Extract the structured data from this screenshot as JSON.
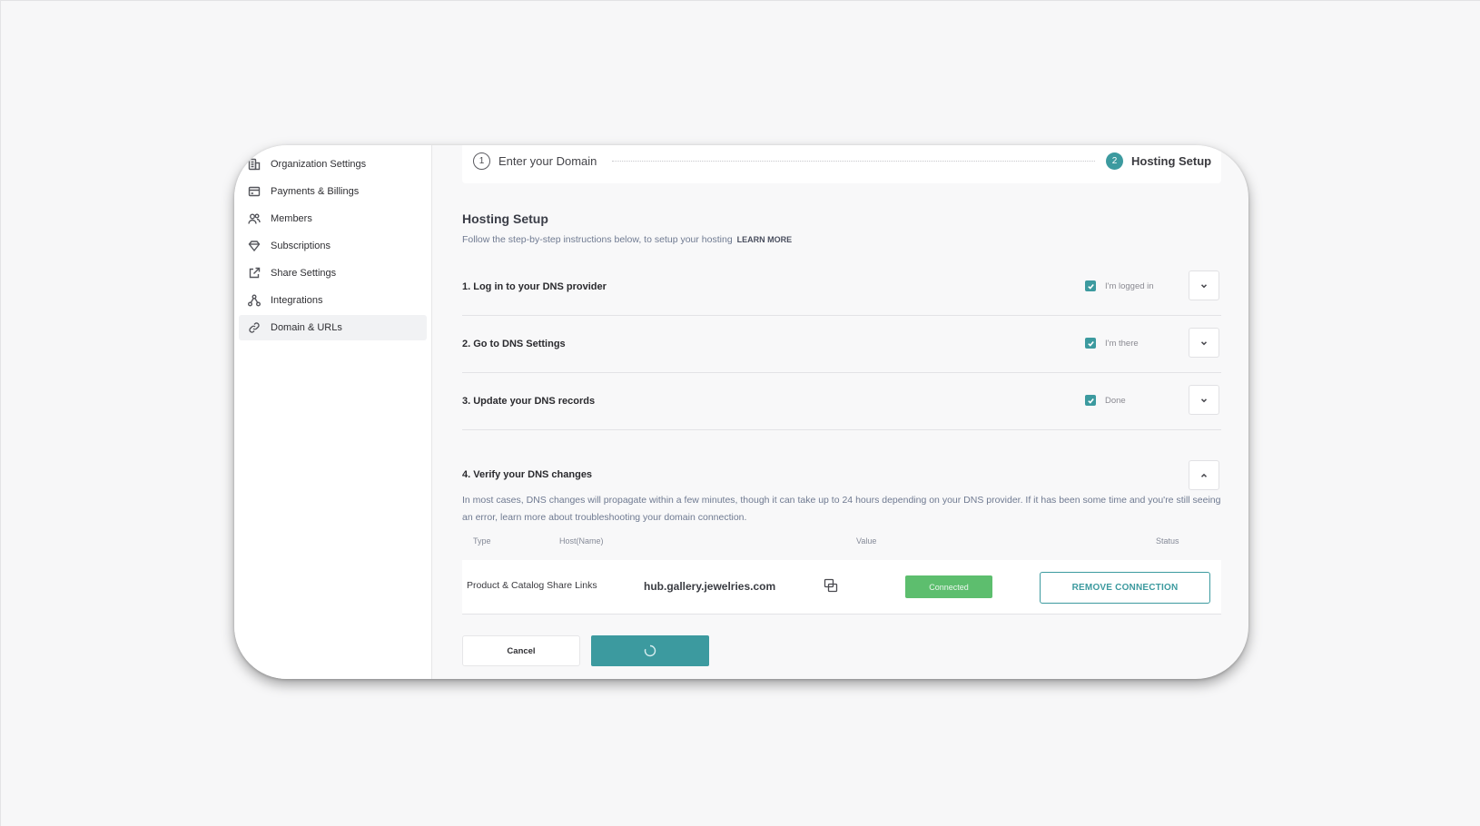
{
  "sidebar": {
    "items": [
      {
        "label": "Organization Settings",
        "icon": "building-icon"
      },
      {
        "label": "Payments & Billings",
        "icon": "card-icon"
      },
      {
        "label": "Members",
        "icon": "users-icon"
      },
      {
        "label": "Subscriptions",
        "icon": "tag-icon"
      },
      {
        "label": "Share Settings",
        "icon": "share-icon"
      },
      {
        "label": "Integrations",
        "icon": "integration-icon"
      },
      {
        "label": "Domain & URLs",
        "icon": "link-icon",
        "active": true
      }
    ]
  },
  "stepper": {
    "step1_number": "1",
    "step1_label": "Enter your Domain",
    "step2_number": "2",
    "step2_label": "Hosting Setup"
  },
  "header": {
    "title": "Hosting Setup",
    "subtitle": "Follow the step-by-step instructions below, to setup your hosting",
    "learn_more": "LEARN MORE"
  },
  "steps": [
    {
      "title": "1. Log in to your DNS provider",
      "check_label": "I'm logged in",
      "checked": true
    },
    {
      "title": "2. Go to DNS Settings",
      "check_label": "I'm there",
      "checked": true
    },
    {
      "title": "3. Update your DNS records",
      "check_label": "Done",
      "checked": true
    }
  ],
  "verify": {
    "title": "4. Verify your DNS changes",
    "description": "In most cases, DNS changes will propagate within a few minutes, though it can take up to 24 hours depending on your DNS provider. If it has been some time and you're still seeing an error, learn more about troubleshooting your domain connection."
  },
  "table": {
    "headers": [
      "Type",
      "Host(Name)",
      "Value",
      "Status"
    ],
    "row": {
      "type": "Product & Catalog Share Links",
      "host": "hub.gallery.jewelries.com",
      "status": "Connected",
      "remove_label": "REMOVE CONNECTION"
    }
  },
  "footer": {
    "cancel_label": "Cancel"
  },
  "colors": {
    "accent": "#3c9a9f",
    "connected": "#5dbe6e"
  }
}
